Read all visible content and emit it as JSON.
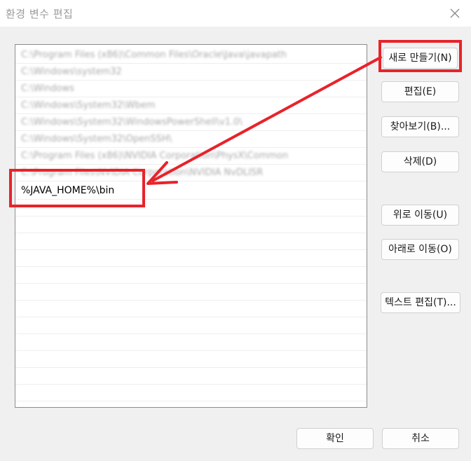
{
  "window": {
    "title": "환경 변수 편집",
    "close_icon": "close-icon"
  },
  "list": {
    "entries": [
      "C:\\Program Files (x86)\\Common Files\\Oracle\\Java\\javapath",
      "C:\\Windows\\system32",
      "C:\\Windows",
      "C:\\Windows\\System32\\Wbem",
      "C:\\Windows\\System32\\WindowsPowerShell\\v1.0\\",
      "C:\\Windows\\System32\\OpenSSH\\",
      "C:\\Program Files (x86)\\NVIDIA Corporation\\PhysX\\Common",
      "C:\\Program Files\\NVIDIA Corporation\\NVIDIA NvDLISR"
    ],
    "edit_value": "%JAVA_HOME%\\bin"
  },
  "buttons": {
    "new": "새로 만들기(N)",
    "edit": "편집(E)",
    "browse": "찾아보기(B)...",
    "delete": "삭제(D)",
    "move_up": "위로 이동(U)",
    "move_down": "아래로 이동(O)",
    "edit_text": "텍스트 편집(T)...",
    "ok": "확인",
    "cancel": "취소"
  },
  "colors": {
    "annotation": "#e8232a"
  }
}
